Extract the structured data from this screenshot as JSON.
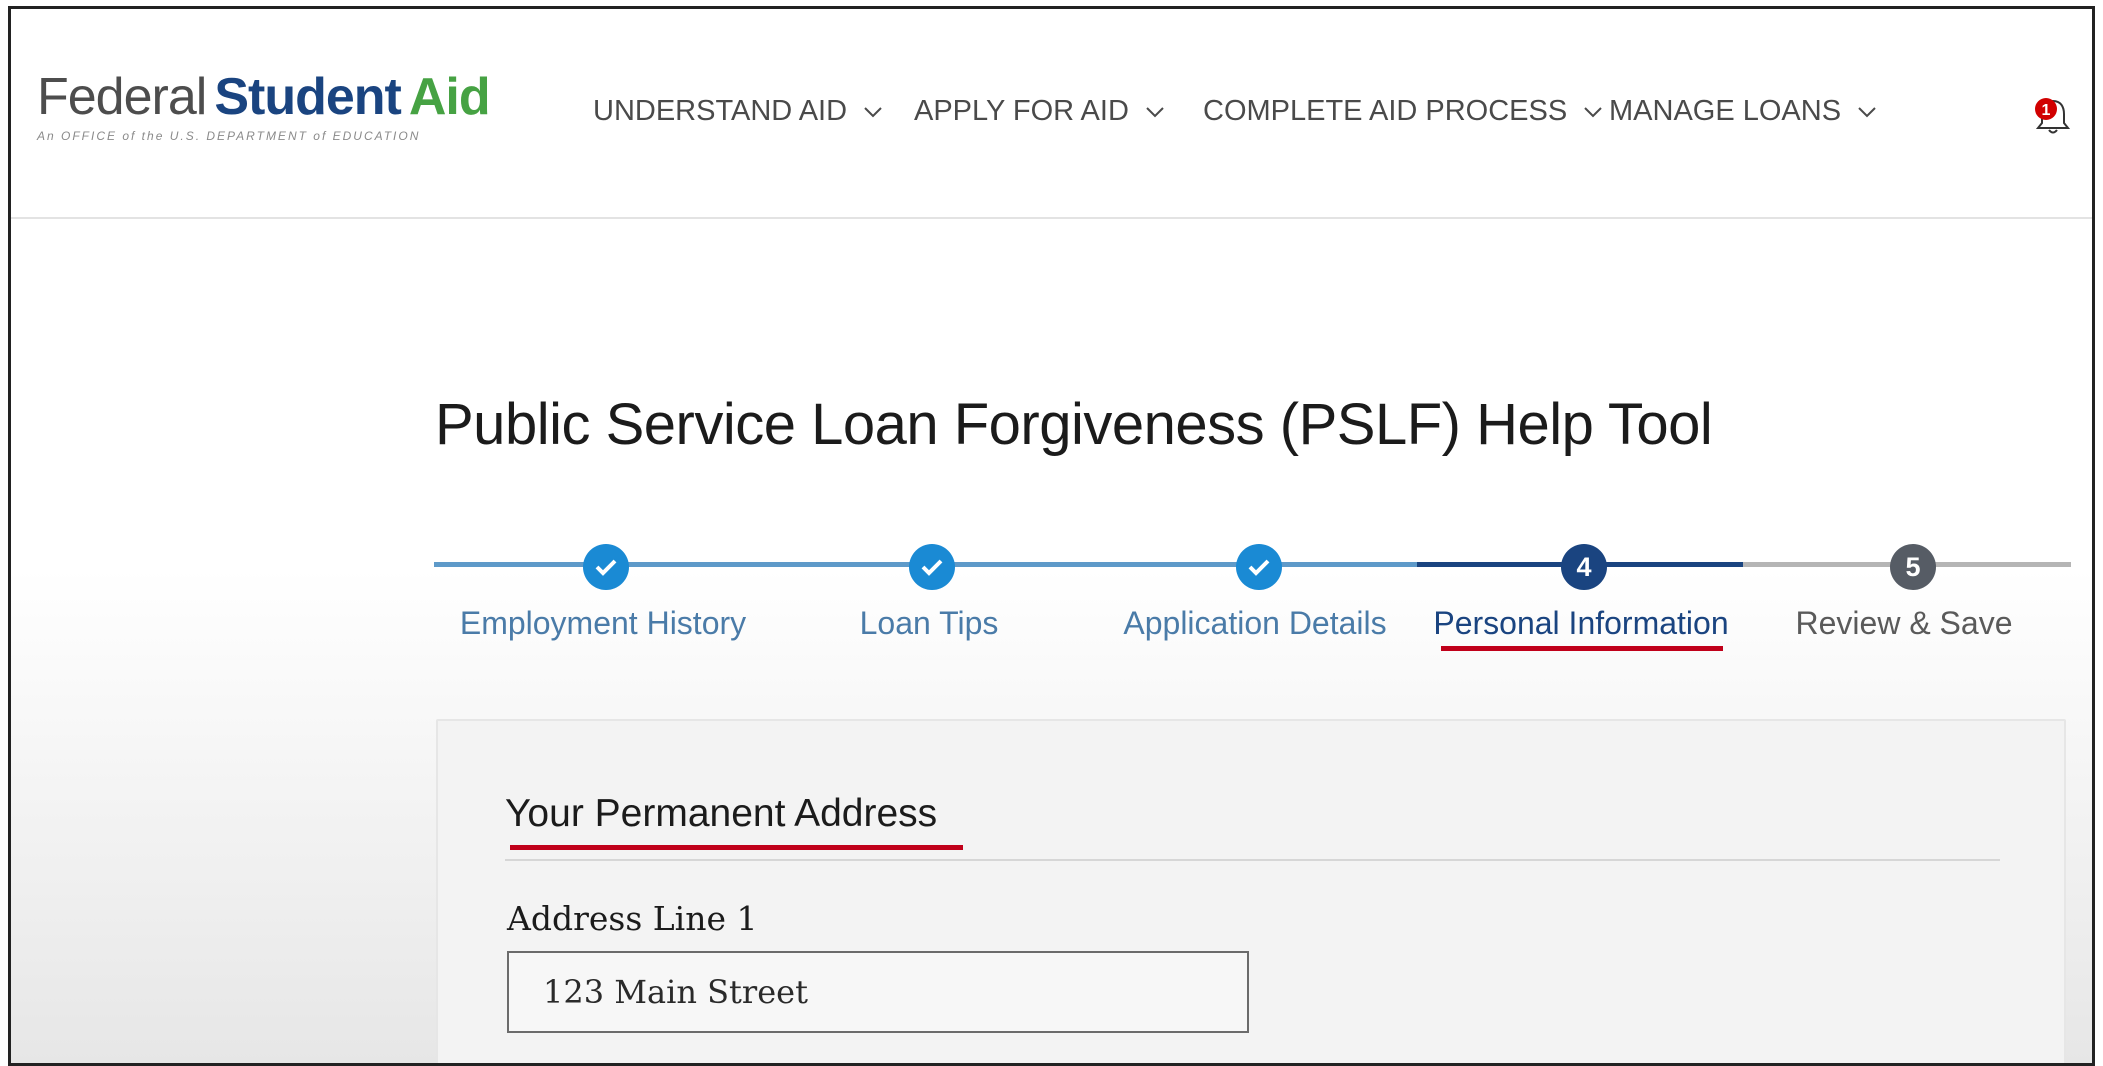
{
  "header": {
    "logo": {
      "word1": "Federal",
      "word2": "Student",
      "word3": "Aid",
      "tagline": "An OFFICE of the U.S. DEPARTMENT of EDUCATION"
    },
    "nav": [
      {
        "label": "UNDERSTAND AID"
      },
      {
        "label": "APPLY FOR AID"
      },
      {
        "label": "COMPLETE AID PROCESS"
      },
      {
        "label": "MANAGE LOANS"
      }
    ],
    "notifications": {
      "count": "1",
      "icon": "bell-icon"
    }
  },
  "main": {
    "title": "Public Service Loan Forgiveness (PSLF) Help Tool",
    "steps": [
      {
        "label": "Employment History",
        "status": "complete"
      },
      {
        "label": "Loan Tips",
        "status": "complete"
      },
      {
        "label": "Application Details",
        "status": "complete"
      },
      {
        "label": "Personal Information",
        "status": "current",
        "number": "4"
      },
      {
        "label": "Review & Save",
        "status": "future",
        "number": "5"
      }
    ],
    "section": {
      "title": "Your Permanent Address",
      "fields": [
        {
          "label": "Address Line 1",
          "value": "123 Main Street"
        }
      ]
    }
  },
  "colors": {
    "complete": "#1a8ad4",
    "current": "#1a4480",
    "future": "#565c65",
    "annotation": "#c0001a",
    "aid_green": "#46a243",
    "student_blue": "#1a4480"
  }
}
